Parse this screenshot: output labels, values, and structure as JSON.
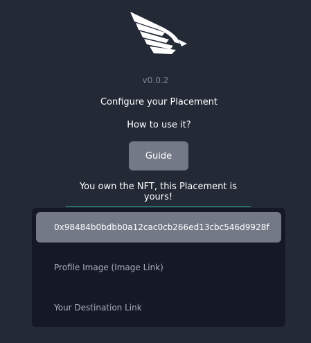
{
  "app": {
    "logo_icon": "wing-icon",
    "version": "v0.0.2",
    "configure_heading": "Configure your Placement",
    "how_to_label": "How to use it?",
    "guide_button_label": "Guide",
    "ownership_message": "You own the NFT, this Placement is yours!"
  },
  "form": {
    "wallet_address": "0x98484b0bdbb0a12cac0cb266ed13cbc546d9928f",
    "profile_image_placeholder": "Profile Image (Image Link)",
    "destination_link_placeholder": "Your Destination Link"
  },
  "colors": {
    "background": "#232a36",
    "panel": "#141925",
    "button": "#737987",
    "accent_underline": "#2bb3a0"
  }
}
